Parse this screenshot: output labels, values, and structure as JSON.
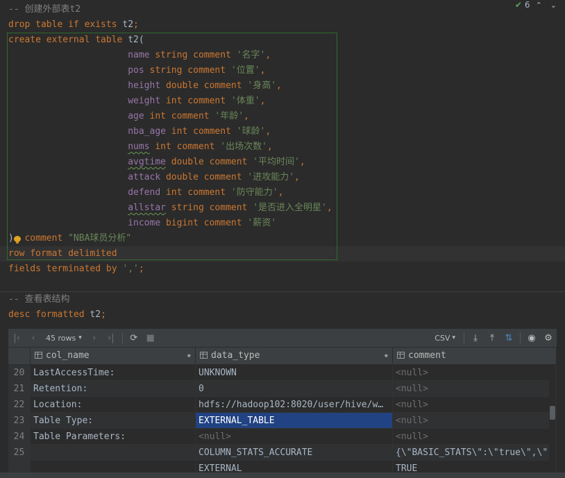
{
  "editor": {
    "indicator": {
      "count": "6"
    },
    "lines1": [
      {
        "tokens": [
          {
            "t": "-- 创建外部表t2",
            "c": "cm"
          }
        ]
      },
      {
        "tokens": [
          {
            "t": "drop table if exists ",
            "c": "kw"
          },
          {
            "t": "t2",
            "c": "id"
          },
          {
            "t": ";",
            "c": "kw"
          }
        ]
      },
      {
        "tokens": [
          {
            "t": "create external table ",
            "c": "kw"
          },
          {
            "t": "t2(",
            "c": "id"
          }
        ]
      },
      {
        "tokens": [
          {
            "t": "                      ",
            "c": "id"
          },
          {
            "t": "name",
            "c": "col"
          },
          {
            "t": " string comment ",
            "c": "kw"
          },
          {
            "t": "'名字'",
            "c": "str"
          },
          {
            "t": ",",
            "c": "kw"
          }
        ]
      },
      {
        "tokens": [
          {
            "t": "                      ",
            "c": "id"
          },
          {
            "t": "pos",
            "c": "col"
          },
          {
            "t": " string comment ",
            "c": "kw"
          },
          {
            "t": "'位置'",
            "c": "str"
          },
          {
            "t": ",",
            "c": "kw"
          }
        ]
      },
      {
        "tokens": [
          {
            "t": "                      ",
            "c": "id"
          },
          {
            "t": "height",
            "c": "col"
          },
          {
            "t": " double comment ",
            "c": "kw"
          },
          {
            "t": "'身高'",
            "c": "str"
          },
          {
            "t": ",",
            "c": "kw"
          }
        ]
      },
      {
        "tokens": [
          {
            "t": "                      ",
            "c": "id"
          },
          {
            "t": "weight",
            "c": "col"
          },
          {
            "t": " int comment ",
            "c": "kw"
          },
          {
            "t": "'体重'",
            "c": "str"
          },
          {
            "t": ",",
            "c": "kw"
          }
        ]
      },
      {
        "tokens": [
          {
            "t": "                      ",
            "c": "id"
          },
          {
            "t": "age",
            "c": "col"
          },
          {
            "t": " int comment ",
            "c": "kw"
          },
          {
            "t": "'年龄'",
            "c": "str"
          },
          {
            "t": ",",
            "c": "kw"
          }
        ]
      },
      {
        "tokens": [
          {
            "t": "                      ",
            "c": "id"
          },
          {
            "t": "nba_age",
            "c": "col"
          },
          {
            "t": " int comment ",
            "c": "kw"
          },
          {
            "t": "'球龄'",
            "c": "str"
          },
          {
            "t": ",",
            "c": "kw"
          }
        ]
      },
      {
        "tokens": [
          {
            "t": "                      ",
            "c": "id"
          },
          {
            "t": "nums",
            "c": "col squig"
          },
          {
            "t": " int comment ",
            "c": "kw"
          },
          {
            "t": "'出场次数'",
            "c": "str"
          },
          {
            "t": ",",
            "c": "kw"
          }
        ]
      },
      {
        "tokens": [
          {
            "t": "                      ",
            "c": "id"
          },
          {
            "t": "avgtime",
            "c": "col squig"
          },
          {
            "t": " double comment ",
            "c": "kw"
          },
          {
            "t": "'平均时间'",
            "c": "str"
          },
          {
            "t": ",",
            "c": "kw"
          }
        ]
      },
      {
        "tokens": [
          {
            "t": "                      ",
            "c": "id"
          },
          {
            "t": "attack",
            "c": "col"
          },
          {
            "t": " double comment ",
            "c": "kw"
          },
          {
            "t": "'进攻能力'",
            "c": "str"
          },
          {
            "t": ",",
            "c": "kw"
          }
        ]
      },
      {
        "tokens": [
          {
            "t": "                      ",
            "c": "id"
          },
          {
            "t": "defend",
            "c": "col"
          },
          {
            "t": " int comment ",
            "c": "kw"
          },
          {
            "t": "'防守能力'",
            "c": "str"
          },
          {
            "t": ",",
            "c": "kw"
          }
        ]
      },
      {
        "tokens": [
          {
            "t": "                      ",
            "c": "id"
          },
          {
            "t": "allstar",
            "c": "col squig"
          },
          {
            "t": " string comment ",
            "c": "kw"
          },
          {
            "t": "'是否进入全明星'",
            "c": "str"
          },
          {
            "t": ",",
            "c": "kw"
          }
        ]
      },
      {
        "tokens": [
          {
            "t": "                      ",
            "c": "id"
          },
          {
            "t": "income",
            "c": "col"
          },
          {
            "t": " bigint comment ",
            "c": "kw"
          },
          {
            "t": "'薪资'",
            "c": "str"
          }
        ]
      },
      {
        "tokens": [
          {
            "t": ")",
            "c": "id"
          },
          {
            "t": "  comment ",
            "c": "kw"
          },
          {
            "t": "\"NBA球员分析\"",
            "c": "str"
          }
        ]
      },
      {
        "tokens": [
          {
            "t": "row format delimited",
            "c": "kw"
          }
        ]
      },
      {
        "tokens": [
          {
            "t": "fields terminated by ",
            "c": "kw"
          },
          {
            "t": "','",
            "c": "str"
          },
          {
            "t": ";",
            "c": "kw"
          }
        ]
      }
    ],
    "lines2": [
      {
        "tokens": [
          {
            "t": "-- 查看表结构",
            "c": "cm"
          }
        ]
      },
      {
        "tokens": [
          {
            "t": "desc formatted ",
            "c": "kw"
          },
          {
            "t": "t2",
            "c": "id"
          },
          {
            "t": ";",
            "c": "kw"
          }
        ]
      }
    ]
  },
  "results": {
    "rows_label": "45 rows",
    "export_format": "CSV",
    "columns": [
      "col_name",
      "data_type",
      "comment"
    ],
    "rows": [
      {
        "n": "20",
        "c1": "LastAccessTime:",
        "c2": "UNKNOWN",
        "c3": "<null>"
      },
      {
        "n": "21",
        "c1": "Retention:",
        "c2": "0",
        "c3": "<null>"
      },
      {
        "n": "22",
        "c1": "Location:",
        "c2": "hdfs://hadoop102:8020/user/hive/w…",
        "c3": "<null>"
      },
      {
        "n": "23",
        "c1": "Table Type:",
        "c2": "EXTERNAL_TABLE",
        "c3": "<null>"
      },
      {
        "n": "24",
        "c1": "Table Parameters:",
        "c2": "<null>",
        "c3": "<null>"
      },
      {
        "n": "25",
        "c1": "",
        "c2": "COLUMN_STATS_ACCURATE",
        "c3": "{\\\"BASIC_STATS\\\":\\\"true\\\",\\\""
      },
      {
        "n": "",
        "c1": "",
        "c2": "EXTERNAL",
        "c3": "TRUE"
      }
    ]
  },
  "colors": {
    "keyword": "#cc7832",
    "string": "#6a8759",
    "column": "#9876aa",
    "comment": "#808080",
    "selection": "#214283"
  }
}
